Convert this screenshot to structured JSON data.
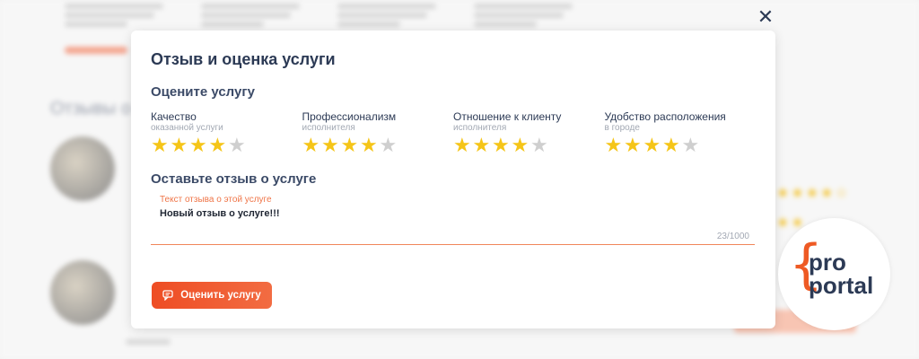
{
  "modal": {
    "close_label": "✕",
    "title": "Отзыв и оценка услуги",
    "rate_heading": "Оцените услугу",
    "criteria": [
      {
        "label": "Качество",
        "sublabel": "оказанной услуги",
        "rating": 4,
        "max": 5
      },
      {
        "label": "Профессионализм",
        "sublabel": "исполнителя",
        "rating": 4,
        "max": 5
      },
      {
        "label": "Отношение к клиенту",
        "sublabel": "исполнителя",
        "rating": 4,
        "max": 5
      },
      {
        "label": "Удобство расположения",
        "sublabel": "в городе",
        "rating": 4,
        "max": 5
      }
    ],
    "review_heading": "Оставьте отзыв о услуге",
    "review_field": {
      "label": "Текст отзыва о этой услуге",
      "value": "Новый отзыв о услуге!!!",
      "counter": "23/1000"
    },
    "submit_label": "Оценить услугу"
  },
  "background": {
    "section_title": "Отзывы о"
  },
  "logo": {
    "brace": "{",
    "line1": "pro",
    "line2": "portal"
  },
  "colors": {
    "accent": "#ee4d24",
    "star_on": "#f5c518",
    "star_off": "#cfcfcf",
    "heading": "#2c3a55"
  }
}
